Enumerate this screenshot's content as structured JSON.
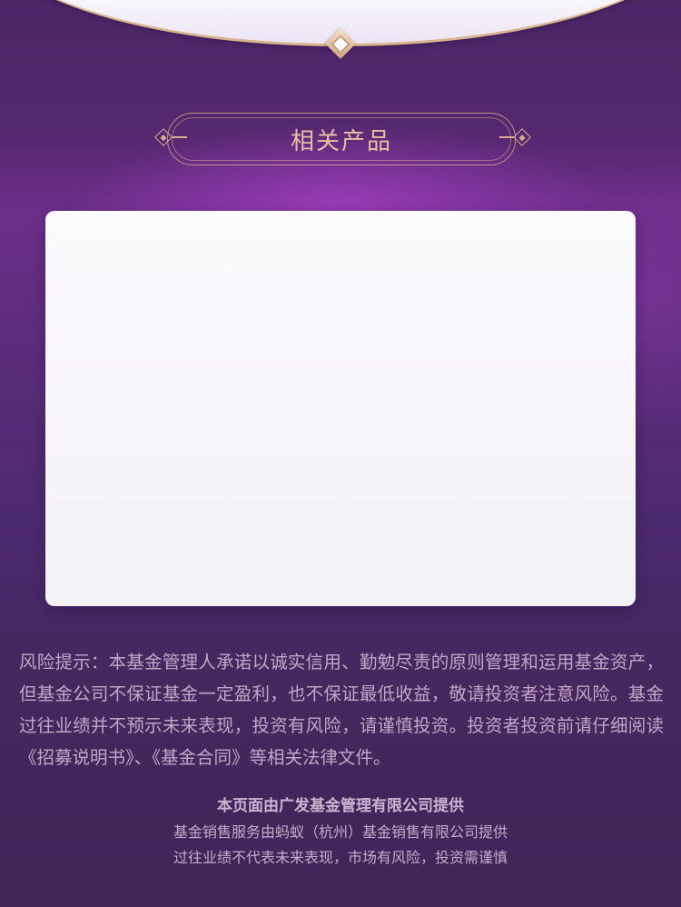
{
  "section": {
    "title": "相关产品"
  },
  "disclaimer": {
    "text": "风险提示：本基金管理人承诺以诚实信用、勤勉尽责的原则管理和运用基金资产，但基金公司不保证基金一定盈利，也不保证最低收益，敬请投资者注意风险。基金过往业绩并不预示未来表现，投资有风险，请谨慎投资。投资者投资前请仔细阅读《招募说明书》、《基金合同》等相关法律文件。"
  },
  "footer": {
    "provider": "本页面由广发基金管理有限公司提供",
    "sales_service": "基金销售服务由蚂蚁（杭州）基金销售有限公司提供",
    "risk_note": "过往业绩不代表未来表现，市场有风险，投资需谨慎"
  },
  "colors": {
    "background": "#55286f",
    "accent_gold": "#d9ad8e",
    "title_text": "#e8bfa2",
    "disclaimer_text": "#c3a5c8",
    "card": "#f8f6fa"
  },
  "icons": {
    "top": "diamond-medallion-icon",
    "ornament": "diamond-ornament-icon"
  }
}
